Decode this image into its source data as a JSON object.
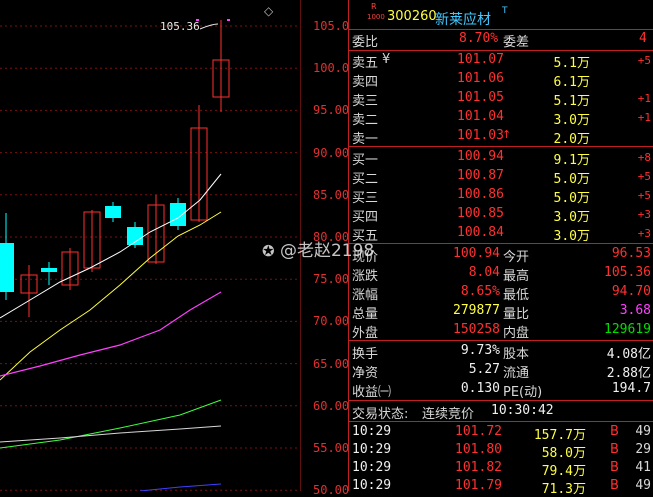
{
  "header": {
    "badge": "R",
    "badge_sub": "1000",
    "code": "300260",
    "name": "新莱应材",
    "mark": "T"
  },
  "chart": {
    "top_price_label": "105.36",
    "axis_ticks": [
      "105.0",
      "100.0",
      "95.00",
      "90.00",
      "85.00",
      "80.00",
      "75.00",
      "70.00",
      "65.00",
      "60.00",
      "55.00",
      "50.00"
    ],
    "colors": {
      "up": "#ff3030",
      "down": "#00ffff",
      "ma5": "#ffffff",
      "ma10": "#ffff40",
      "ma20": "#ff40ff",
      "ma30": "#40ff40"
    }
  },
  "committee": {
    "ratio_label": "委比",
    "ratio_value": "8.70%",
    "diff_label": "委差",
    "diff_value": "4"
  },
  "sell": [
    {
      "label": "卖五",
      "extra": "¥",
      "price": "101.07",
      "vol": "5.1万",
      "chg": "+5"
    },
    {
      "label": "卖四",
      "extra": "",
      "price": "101.06",
      "vol": "6.1万",
      "chg": ""
    },
    {
      "label": "卖三",
      "extra": "",
      "price": "101.05",
      "vol": "5.1万",
      "chg": "+1"
    },
    {
      "label": "卖二",
      "extra": "",
      "price": "101.04",
      "vol": "3.0万",
      "chg": "+1"
    },
    {
      "label": "卖一",
      "extra": "",
      "price": "101.03",
      "vol": "2.0万",
      "chg": "",
      "arrow": "↑"
    }
  ],
  "buy": [
    {
      "label": "买一",
      "price": "100.94",
      "vol": "9.1万",
      "chg": "+8"
    },
    {
      "label": "买二",
      "price": "100.87",
      "vol": "5.0万",
      "chg": "+5"
    },
    {
      "label": "买三",
      "price": "100.86",
      "vol": "5.0万",
      "chg": "+5"
    },
    {
      "label": "买四",
      "price": "100.85",
      "vol": "3.0万",
      "chg": "+3"
    },
    {
      "label": "买五",
      "price": "100.84",
      "vol": "3.0万",
      "chg": "+3"
    }
  ],
  "stats": [
    {
      "l1": "现价",
      "v1": "100.94",
      "l2": "今开",
      "v2": "96.53"
    },
    {
      "l1": "涨跌",
      "v1": "8.04",
      "l2": "最高",
      "v2": "105.36"
    },
    {
      "l1": "涨幅",
      "v1": "8.65%",
      "l2": "最低",
      "v2": "94.70"
    },
    {
      "l1": "总量",
      "v1": "279877",
      "l2": "量比",
      "v2": "3.68"
    },
    {
      "l1": "外盘",
      "v1": "150258",
      "l2": "内盘",
      "v2": "129619"
    }
  ],
  "fundamentals": [
    {
      "l1": "换手",
      "v1": "9.73%",
      "l2": "股本",
      "v2": "4.08亿"
    },
    {
      "l1": "净资",
      "v1": "5.27",
      "l2": "流通",
      "v2": "2.88亿"
    },
    {
      "l1": "收益㈠",
      "v1": "0.130",
      "l2": "PE(动)",
      "v2": "194.7"
    }
  ],
  "trade_status": {
    "label": "交易状态:",
    "value": "连续竞价",
    "time": "10:30:42"
  },
  "ticks": [
    {
      "time": "10:29",
      "price": "101.72",
      "vol": "157.7万",
      "side": "B",
      "n": "49"
    },
    {
      "time": "10:29",
      "price": "101.80",
      "vol": "58.0万",
      "side": "B",
      "n": "29"
    },
    {
      "time": "10:29",
      "price": "101.82",
      "vol": "79.4万",
      "side": "B",
      "n": "41"
    },
    {
      "time": "10:29",
      "price": "101.79",
      "vol": "71.3万",
      "side": "B",
      "n": "49"
    }
  ],
  "watermark": "@老赵2198"
}
